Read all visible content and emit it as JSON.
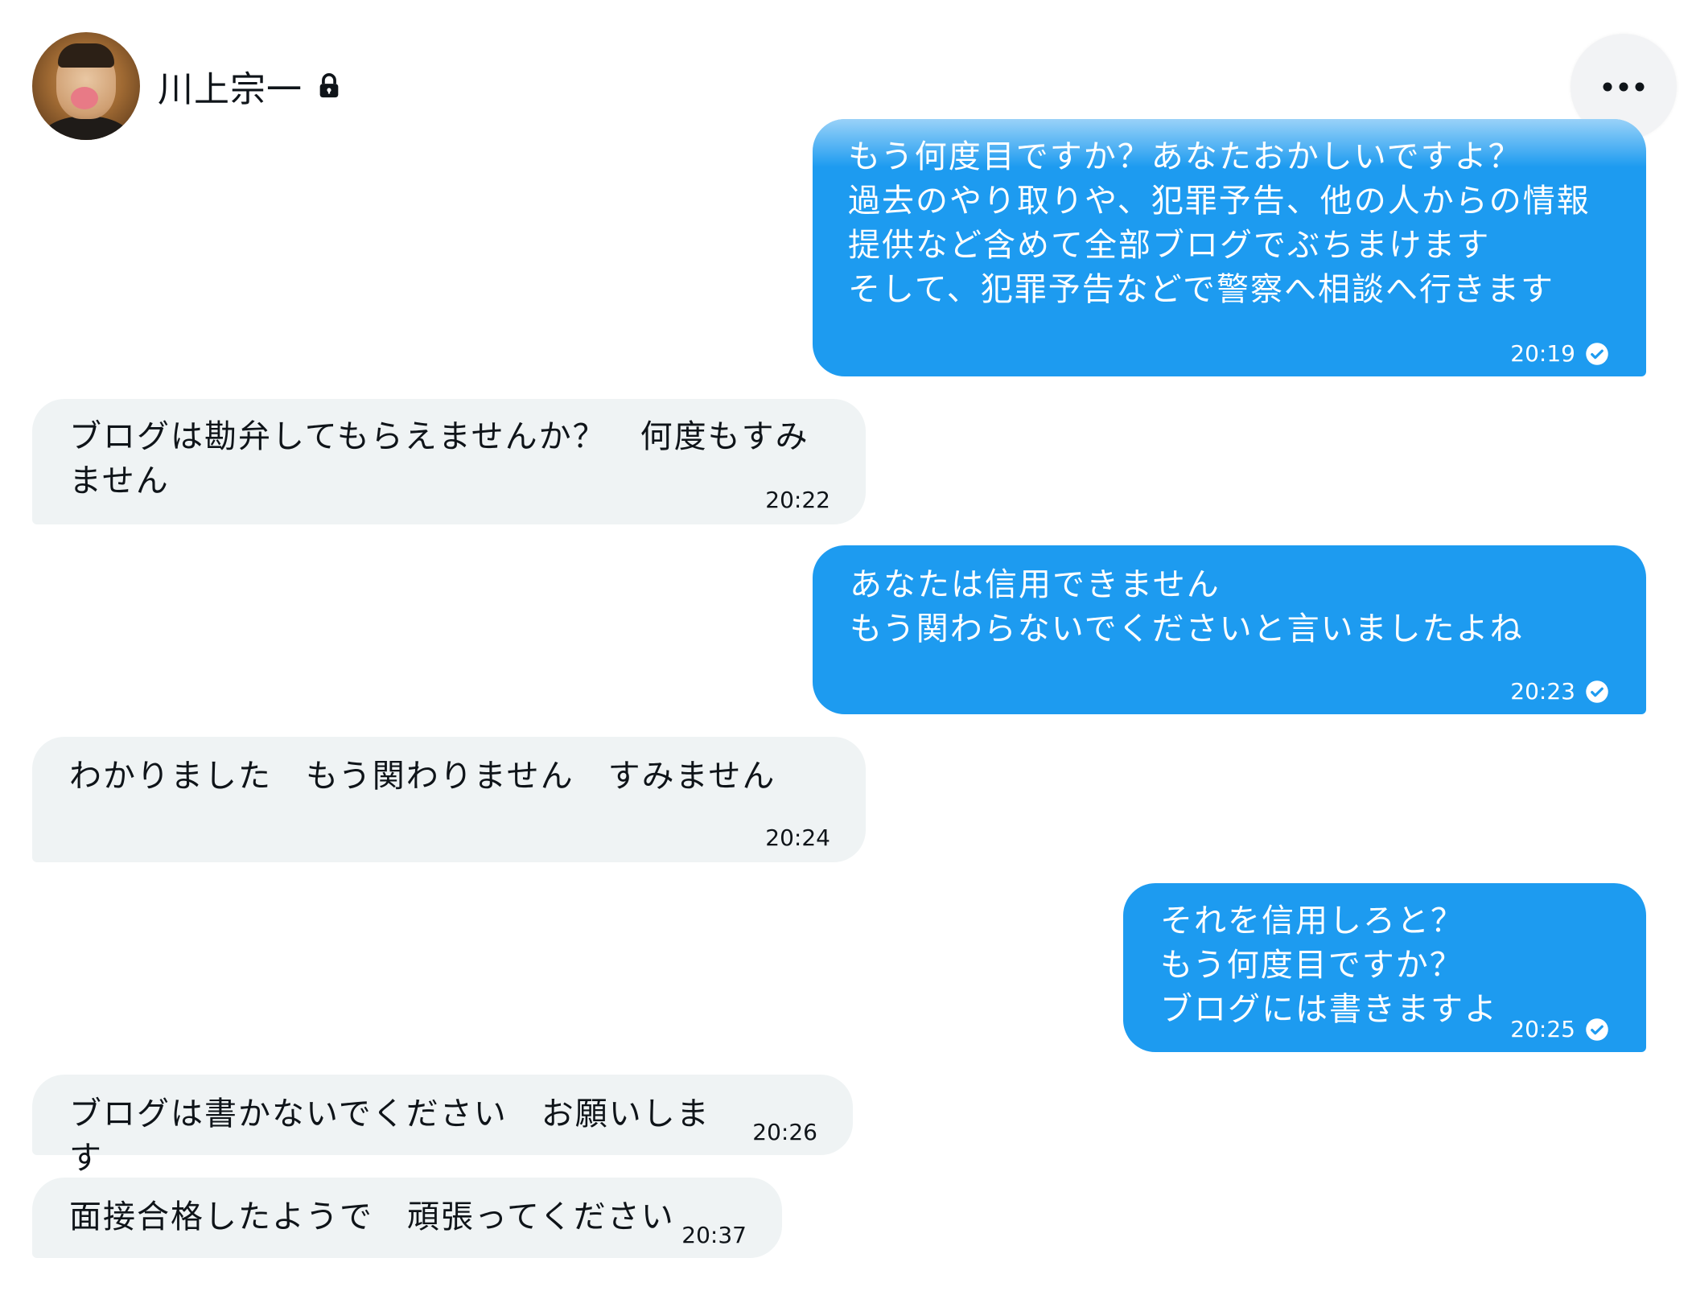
{
  "header": {
    "name": "川上宗一",
    "lock_icon": "lock-icon",
    "more_icon": "more-horizontal-icon"
  },
  "colors": {
    "sent_bubble": "#1d9bf0",
    "received_bubble": "#eff3f4",
    "text_dark": "#0f1419"
  },
  "messages": [
    {
      "direction": "sent",
      "text": "もう何度目ですか？あなたおかしいですよ？\n過去のやり取りや、犯罪予告、他の人からの情報\n提供など含めて全部ブログでぶちまけます\nそして、犯罪予告などで警察へ相談へ行きます",
      "time": "20:19",
      "status_icon": "check-circle-icon"
    },
    {
      "direction": "received",
      "text": "ブログは勘弁してもらえませんか？　何度もすみ\nません",
      "time": "20:22"
    },
    {
      "direction": "sent",
      "text": "あなたは信用できません\nもう関わらないでくださいと言いましたよね",
      "time": "20:23",
      "status_icon": "check-circle-icon"
    },
    {
      "direction": "received",
      "text": "わかりました　もう関わりません　すみません",
      "time": "20:24"
    },
    {
      "direction": "sent",
      "text": "それを信用しろと？\nもう何度目ですか？\nブログには書きますよ",
      "time": "20:25",
      "status_icon": "check-circle-icon"
    },
    {
      "direction": "received",
      "text": "ブログは書かないでください　お願いします",
      "time": "20:26"
    },
    {
      "direction": "received",
      "text": "面接合格したようで　頑張ってください",
      "time": "20:37"
    }
  ]
}
